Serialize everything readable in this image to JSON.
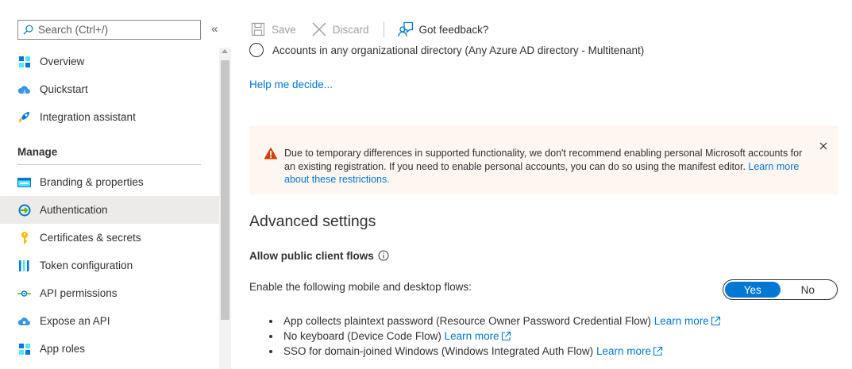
{
  "sidebar": {
    "search_placeholder": "Search (Ctrl+/)",
    "collapse_label": "«",
    "items_top": [
      {
        "label": "Overview",
        "icon": "overview-grid-icon"
      },
      {
        "label": "Quickstart",
        "icon": "quickstart-cloud-icon"
      },
      {
        "label": "Integration assistant",
        "icon": "rocket-icon"
      }
    ],
    "section_manage": "Manage",
    "items_manage": [
      {
        "label": "Branding & properties",
        "icon": "branding-icon"
      },
      {
        "label": "Authentication",
        "icon": "authentication-icon",
        "active": true
      },
      {
        "label": "Certificates & secrets",
        "icon": "key-icon"
      },
      {
        "label": "Token configuration",
        "icon": "token-bars-icon"
      },
      {
        "label": "API permissions",
        "icon": "api-permissions-icon"
      },
      {
        "label": "Expose an API",
        "icon": "cloud-api-icon"
      },
      {
        "label": "App roles",
        "icon": "app-roles-grid-icon"
      }
    ]
  },
  "toolbar": {
    "save_label": "Save",
    "discard_label": "Discard",
    "feedback_label": "Got feedback?"
  },
  "content": {
    "radio_label": "Accounts in any organizational directory (Any Azure AD directory - Multitenant)",
    "help_link": "Help me decide...",
    "warning_text": "Due to temporary differences in supported functionality, we don't recommend enabling personal Microsoft accounts for an existing registration. If you need to enable personal accounts, you can do so using the manifest editor.",
    "warning_link": "Learn more about these restrictions.",
    "advanced_title": "Advanced settings",
    "public_client_label": "Allow public client flows",
    "enable_label": "Enable the following mobile and desktop flows:",
    "toggle_yes": "Yes",
    "toggle_no": "No",
    "toggle_value": "Yes",
    "flows": [
      {
        "text": "App collects plaintext password (Resource Owner Password Credential Flow)",
        "link": "Learn more"
      },
      {
        "text": "No keyboard (Device Code Flow)",
        "link": "Learn more"
      },
      {
        "text": "SSO for domain-joined Windows (Windows Integrated Auth Flow)",
        "link": "Learn more"
      }
    ]
  },
  "colors": {
    "accent": "#0078d4",
    "warning_bg": "#fdf6f1",
    "warning_icon": "#d83b01",
    "active_nav_bg": "#edebe9"
  }
}
